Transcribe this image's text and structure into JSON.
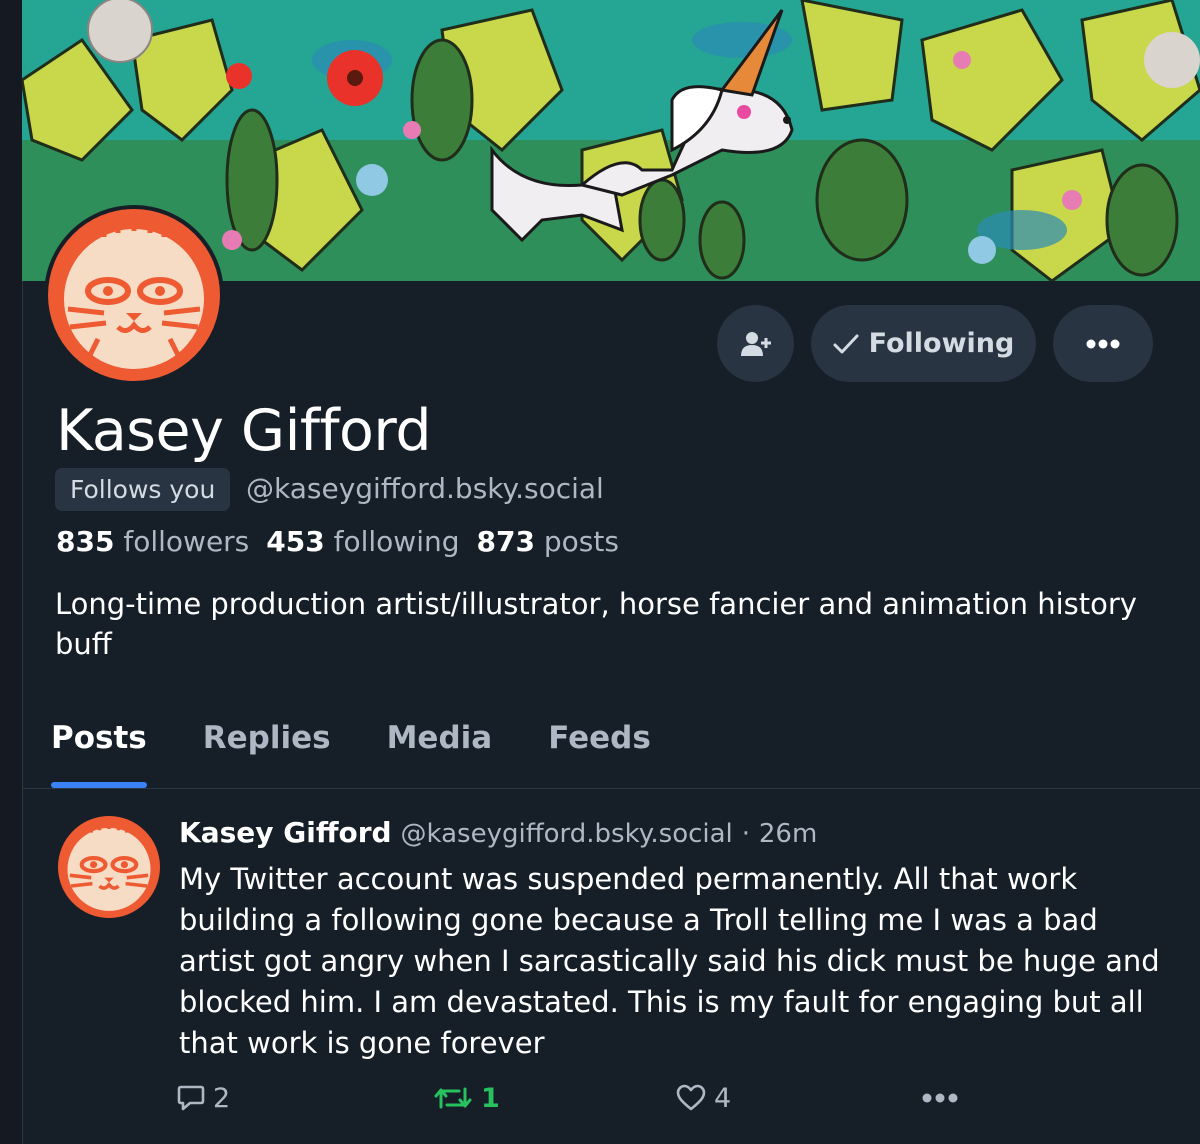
{
  "profile": {
    "display_name": "Kasey Gifford",
    "follows_you_label": "Follows you",
    "handle": "@kaseygifford.bsky.social",
    "followers_count": "835",
    "followers_label": "followers",
    "following_count": "453",
    "following_label": "following",
    "posts_count": "873",
    "posts_label": "posts",
    "bio": "Long-time production artist/illustrator, horse fancier and animation history buff"
  },
  "actions": {
    "add_icon": "person-add-icon",
    "following_label": "Following",
    "following_icon": "check-icon",
    "more_icon": "ellipsis-icon"
  },
  "tabs": [
    {
      "label": "Posts",
      "active": true
    },
    {
      "label": "Replies",
      "active": false
    },
    {
      "label": "Media",
      "active": false
    },
    {
      "label": "Feeds",
      "active": false
    }
  ],
  "post": {
    "author_name": "Kasey Gifford",
    "author_handle": "@kaseygifford.bsky.social",
    "separator": "·",
    "time": "26m",
    "text": "My Twitter account was suspended permanently. All that work building a following gone because a Troll telling me I was a bad artist got angry when I sarcastically said his dick must be huge and blocked him. I am devastated. This is my fault for engaging but all that work is gone forever",
    "reply_count": "2",
    "repost_count": "1",
    "like_count": "4"
  },
  "colors": {
    "background": "#161e27",
    "button_bg": "#283442",
    "accent_blue": "#3b82f6",
    "repost_green": "#27c25f",
    "muted_text": "#aeb8c4"
  }
}
